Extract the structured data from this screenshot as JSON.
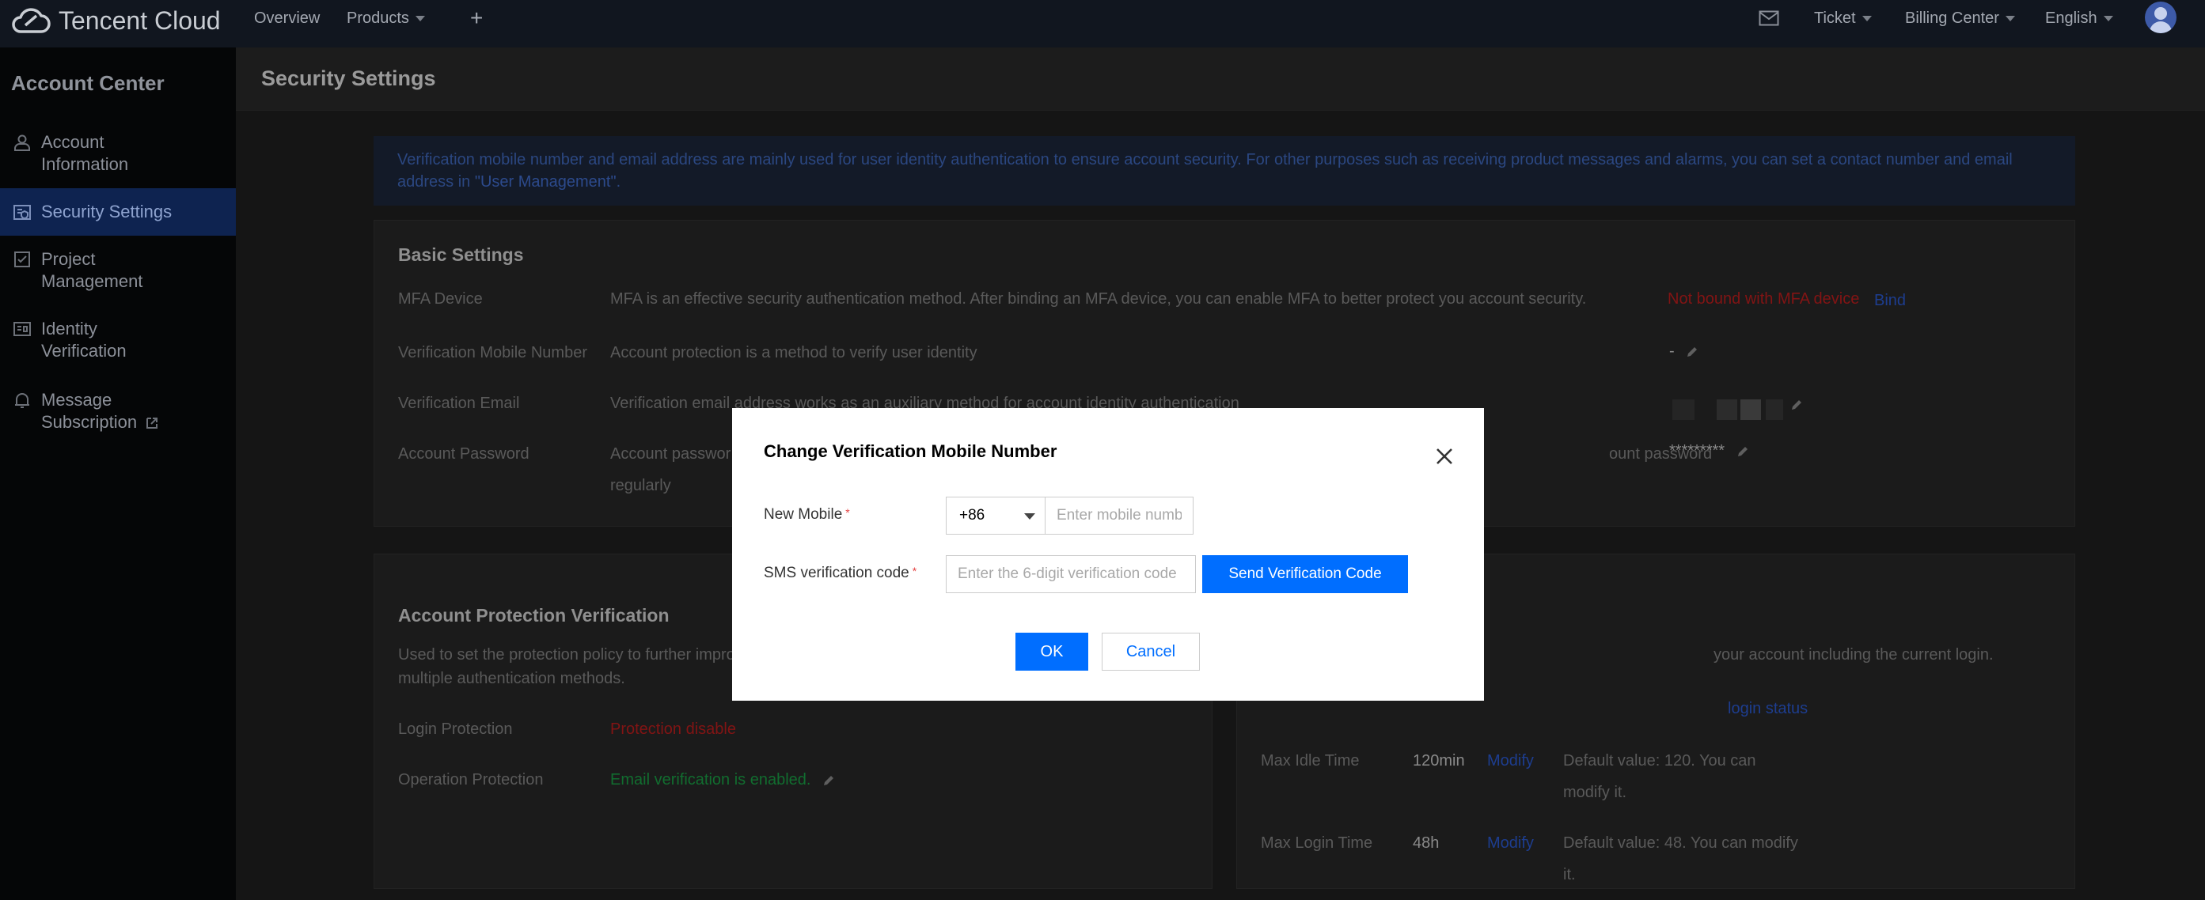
{
  "topbar": {
    "brand": "Tencent Cloud",
    "overview": "Overview",
    "products": "Products",
    "plus": "+",
    "ticket": "Ticket",
    "billing": "Billing Center",
    "language": "English"
  },
  "sidebar": {
    "title": "Account Center",
    "items": [
      {
        "line1": "Account",
        "line2": "Information"
      },
      {
        "line1": "Security Settings",
        "line2": ""
      },
      {
        "line1": "Project",
        "line2": "Management"
      },
      {
        "line1": "Identity",
        "line2": "Verification"
      },
      {
        "line1": "Message",
        "line2": "Subscription"
      }
    ]
  },
  "page": {
    "title": "Security Settings",
    "notice_text": "Verification mobile number and email address are mainly used for user identity authentication to ensure account security. For other purposes such as receiving product messages and alarms, you can set a contact number and email address in",
    "notice_link": "\"User Management\"",
    "notice_end": "."
  },
  "basic": {
    "title": "Basic Settings",
    "mfa_label": "MFA Device",
    "mfa_desc": "MFA is an effective security authentication method. After binding an MFA device, you can enable MFA to better protect you account security.",
    "mfa_status": "Not bound with MFA device",
    "mfa_bind": "Bind",
    "mobile_label": "Verification Mobile Number",
    "mobile_desc": "Account protection is a method to verify user identity",
    "mobile_value": "-",
    "email_label": "Verification Email",
    "email_desc": "Verification email address works as an auxiliary method for account identity authentication",
    "password_label": "Account Password",
    "password_desc_a": "Account passwor",
    "password_desc_b": "ount password",
    "password_desc_c": "regularly",
    "password_value": "*********"
  },
  "protection": {
    "title": "Account Protection Verification",
    "desc_a": "Used to set the protection policy to further improv",
    "desc_b": "multiple authentication methods.",
    "login_label": "Login Protection",
    "login_status": "Protection disable",
    "op_label": "Operation Protection",
    "op_status": "Email verification is enabled."
  },
  "session": {
    "desc": "your account including the current login.",
    "login_status_link": "login status",
    "idle_label": "Max Idle Time",
    "idle_value": "120min",
    "idle_modify": "Modify",
    "idle_default_a": "Default value: 120. You can",
    "idle_default_b": "modify it.",
    "login_label": "Max Login Time",
    "login_value": "48h",
    "login_modify": "Modify",
    "login_default_a": "Default value: 48. You can modify",
    "login_default_b": "it."
  },
  "modal": {
    "title": "Change Verification Mobile Number",
    "new_mobile_label": "New Mobile",
    "required_mark": "*",
    "country_code": "+86",
    "mobile_placeholder": "Enter mobile numb",
    "sms_label": "SMS verification code",
    "sms_placeholder": "Enter the 6-digit verification code",
    "send_code": "Send Verification Code",
    "ok": "OK",
    "cancel": "Cancel"
  }
}
